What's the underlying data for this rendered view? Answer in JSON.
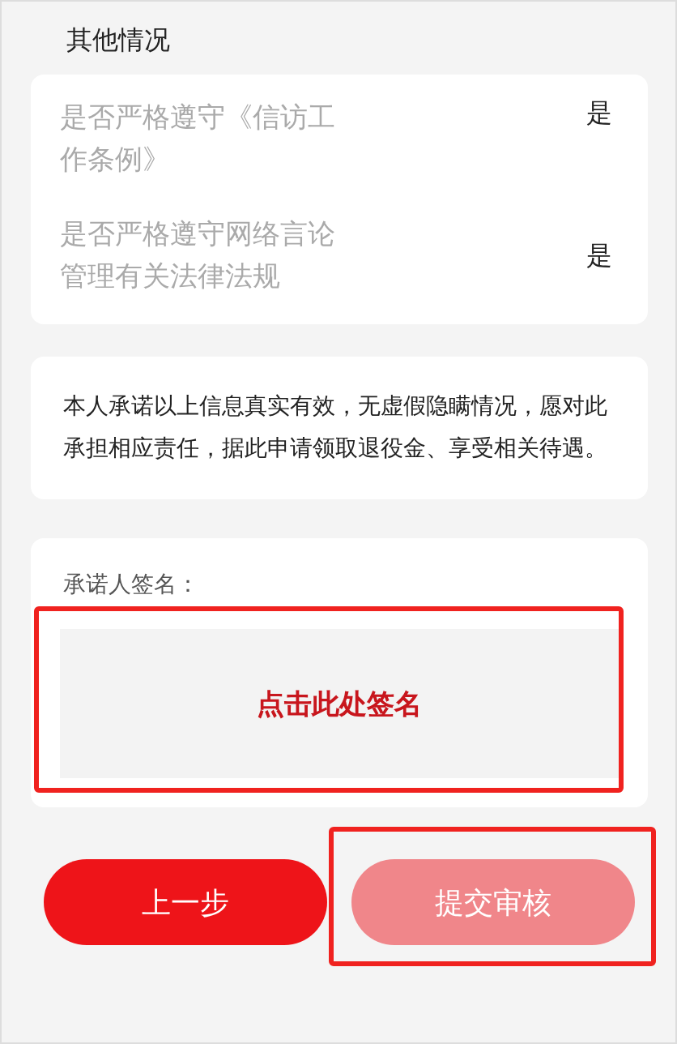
{
  "section_title": "其他情况",
  "questions": [
    {
      "label": "是否严格遵守《信访工作条例》",
      "answer": "是"
    },
    {
      "label": "是否严格遵守网络言论管理有关法律法规",
      "answer": "是"
    }
  ],
  "pledge": "本人承诺以上信息真实有效，无虚假隐瞒情况，愿对此承担相应责任，据此申请领取退役金、享受相关待遇。",
  "signature": {
    "label": "承诺人签名：",
    "placeholder": "点击此处签名",
    "highlighted": true
  },
  "buttons": [
    {
      "label": "上一步",
      "disabled": false,
      "highlighted": false
    },
    {
      "label": "提交审核",
      "disabled": true,
      "highlighted": true
    }
  ]
}
